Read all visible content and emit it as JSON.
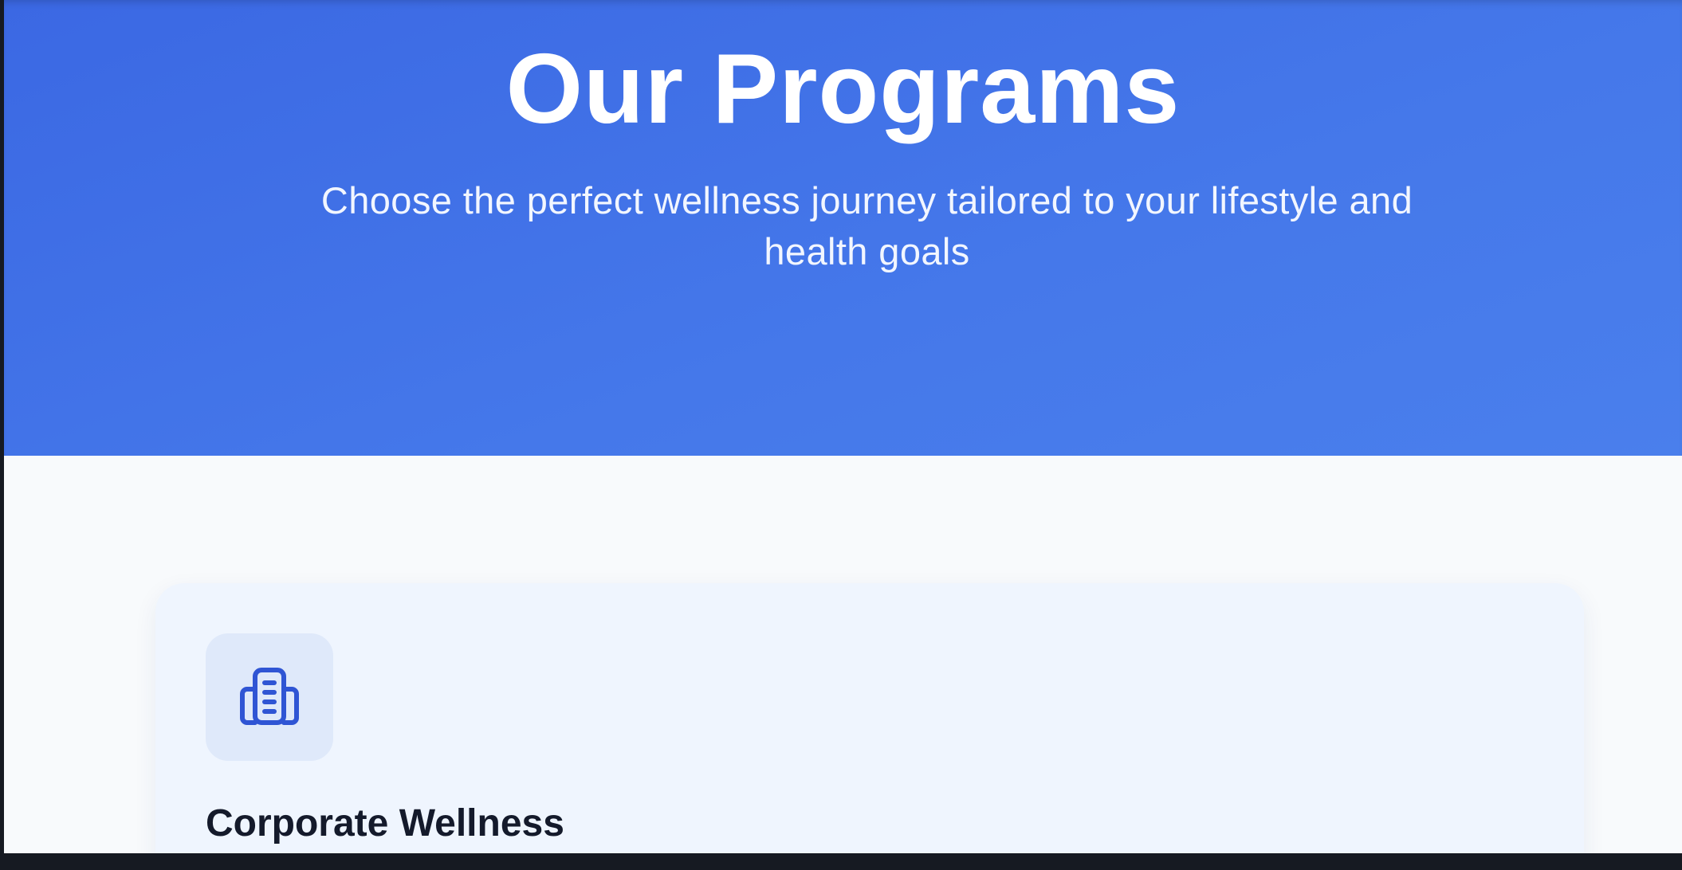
{
  "hero": {
    "title": "Our Programs",
    "subtitle": "Choose the perfect wellness journey tailored to your lifestyle and health goals"
  },
  "programs": [
    {
      "icon": "building-icon",
      "title": "Corporate Wellness"
    }
  ],
  "colors": {
    "hero_gradient_start": "#3b68e3",
    "hero_gradient_end": "#4a7fec",
    "card_background": "#eff5fe",
    "icon_tile": "#dfe9fa",
    "icon_stroke": "#2f55d4",
    "heading_text": "#141a2b"
  }
}
